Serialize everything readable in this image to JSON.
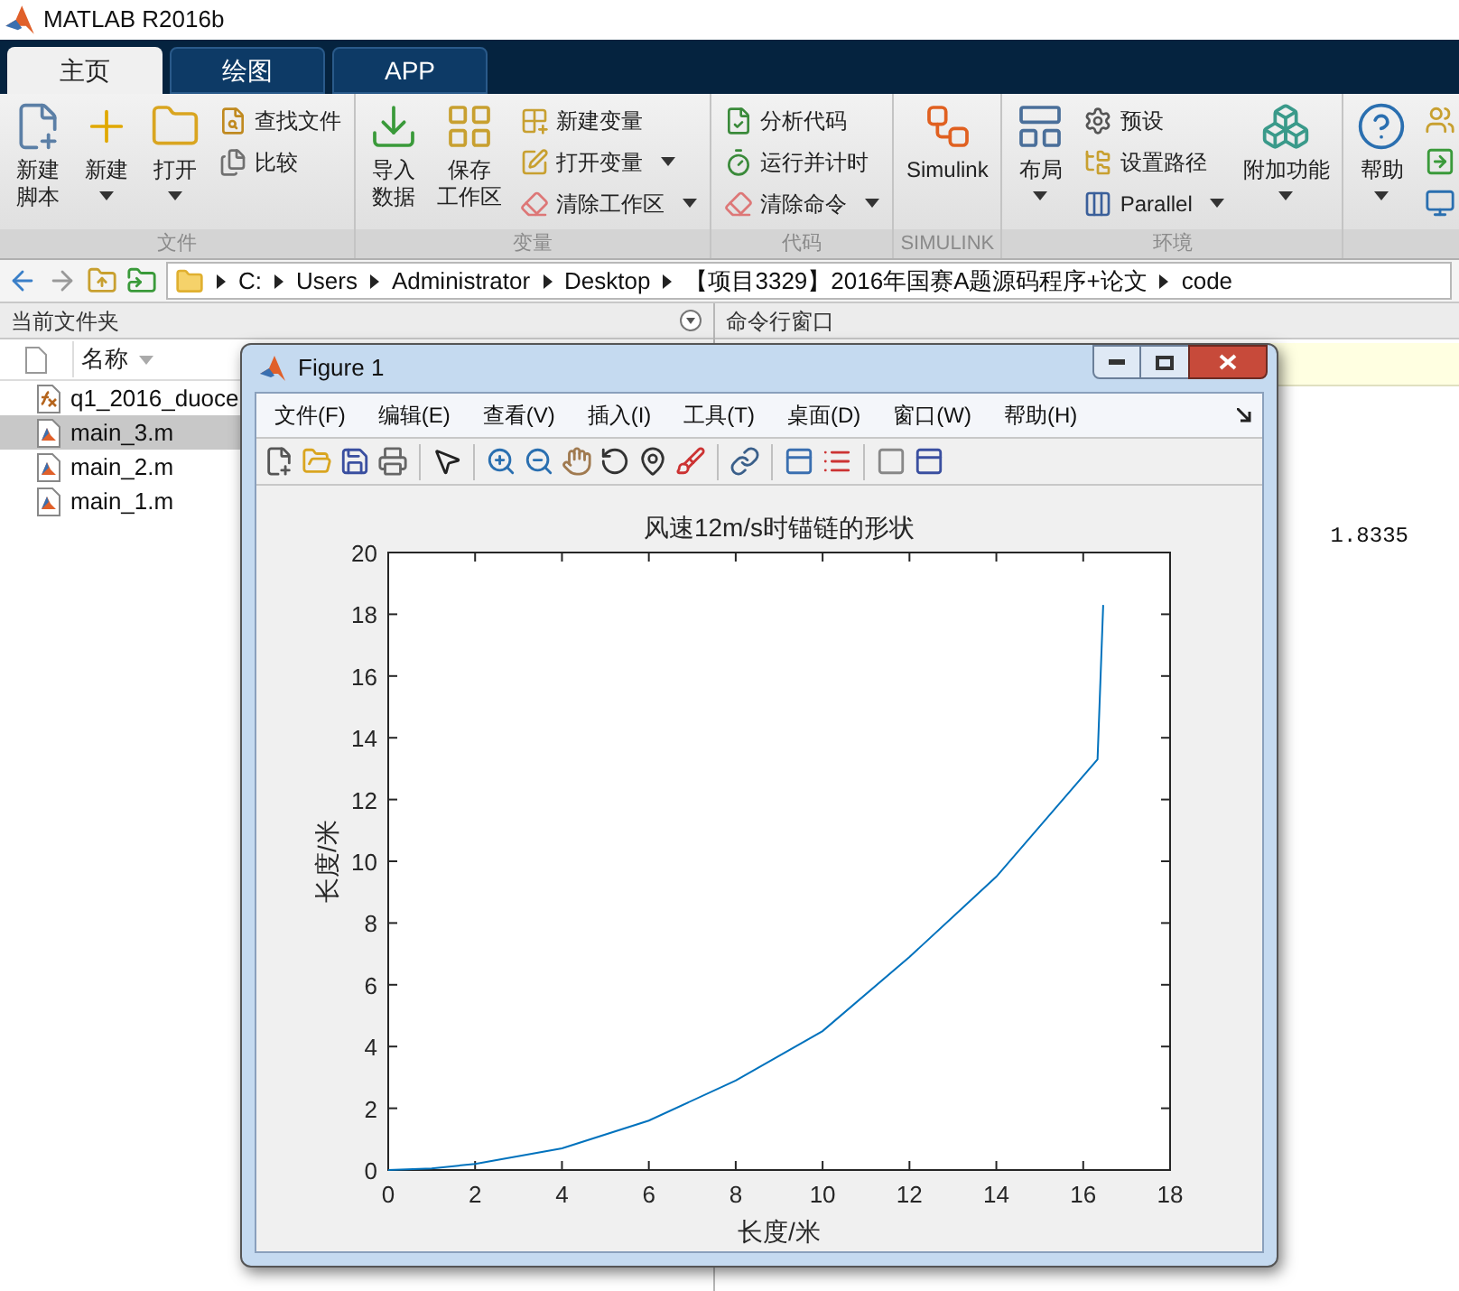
{
  "app": {
    "title": "MATLAB R2016b"
  },
  "tabs": [
    {
      "label": "主页",
      "selected": true
    },
    {
      "label": "绘图",
      "selected": false
    },
    {
      "label": "APP",
      "selected": false
    }
  ],
  "ribbon": [
    {
      "label": "文件",
      "items": [
        {
          "kind": "large",
          "label_lines": [
            "新建",
            "脚本"
          ],
          "dropdown": false
        },
        {
          "kind": "large",
          "label_lines": [
            "新建"
          ],
          "dropdown": true
        },
        {
          "kind": "large",
          "label_lines": [
            "打开"
          ],
          "dropdown": true
        },
        {
          "kind": "small",
          "label": "查找文件",
          "dropdown": false
        },
        {
          "kind": "small",
          "label": "比较",
          "dropdown": false
        }
      ]
    },
    {
      "label": "变量",
      "items": [
        {
          "kind": "large",
          "label_lines": [
            "导入",
            "数据"
          ],
          "dropdown": false
        },
        {
          "kind": "large",
          "label_lines": [
            "保存",
            "工作区"
          ],
          "dropdown": false
        },
        {
          "kind": "small",
          "label": "新建变量",
          "dropdown": false
        },
        {
          "kind": "small",
          "label": "打开变量",
          "dropdown": true
        },
        {
          "kind": "small",
          "label": "清除工作区",
          "dropdown": true
        }
      ]
    },
    {
      "label": "代码",
      "items": [
        {
          "kind": "small",
          "label": "分析代码",
          "dropdown": false
        },
        {
          "kind": "small",
          "label": "运行并计时",
          "dropdown": false
        },
        {
          "kind": "small",
          "label": "清除命令",
          "dropdown": true
        }
      ]
    },
    {
      "label": "SIMULINK",
      "items": [
        {
          "kind": "large",
          "label_lines": [
            "Simulink"
          ],
          "dropdown": false
        }
      ]
    },
    {
      "label": "环境",
      "items": [
        {
          "kind": "large",
          "label_lines": [
            "布局"
          ],
          "dropdown": true
        },
        {
          "kind": "small",
          "label": "预设",
          "dropdown": false
        },
        {
          "kind": "small",
          "label": "设置路径",
          "dropdown": false
        },
        {
          "kind": "small",
          "label": "Parallel",
          "dropdown": true
        },
        {
          "kind": "large",
          "label_lines": [
            "附加功能"
          ],
          "dropdown": true
        }
      ]
    },
    {
      "items": [
        {
          "kind": "large",
          "label_lines": [
            "帮助"
          ],
          "dropdown": true
        },
        {
          "kind": "icons"
        }
      ]
    }
  ],
  "address_bar": {
    "path": [
      "C:",
      "Users",
      "Administrator",
      "Desktop",
      "【项目3329】2016年国赛A题源码程序+论文",
      "code"
    ]
  },
  "current_folder": {
    "title": "当前文件夹",
    "column": "名称",
    "files": [
      {
        "name": "q1_2016_duoce",
        "kind": "function",
        "selected": false
      },
      {
        "name": "main_3.m",
        "kind": "script",
        "selected": true
      },
      {
        "name": "main_2.m",
        "kind": "script",
        "selected": false
      },
      {
        "name": "main_1.m",
        "kind": "script",
        "selected": false
      }
    ]
  },
  "command_window": {
    "title": "命令行窗口",
    "output": "1.8335"
  },
  "figure": {
    "title": "Figure 1",
    "menu": [
      "文件(F)",
      "编辑(E)",
      "查看(V)",
      "插入(I)",
      "工具(T)",
      "桌面(D)",
      "窗口(W)",
      "帮助(H)"
    ],
    "chart_data": {
      "type": "line",
      "title": "风速12m/s时锚链的形状",
      "xlabel": "长度/米",
      "ylabel": "长度/米",
      "x": [
        0,
        1,
        2,
        4,
        6,
        8,
        10,
        12,
        14,
        16.33,
        16.46
      ],
      "series": [
        {
          "color": "#0072bd",
          "values": [
            0,
            0.05,
            0.2,
            0.7,
            1.6,
            2.9,
            4.5,
            6.9,
            9.5,
            13.3,
            18.3
          ]
        }
      ],
      "xlim": [
        0,
        18
      ],
      "ylim": [
        0,
        20
      ],
      "xticks": [
        0,
        2,
        4,
        6,
        8,
        10,
        12,
        14,
        16,
        18
      ],
      "yticks": [
        0,
        2,
        4,
        6,
        8,
        10,
        12,
        14,
        16,
        18,
        20
      ]
    }
  }
}
